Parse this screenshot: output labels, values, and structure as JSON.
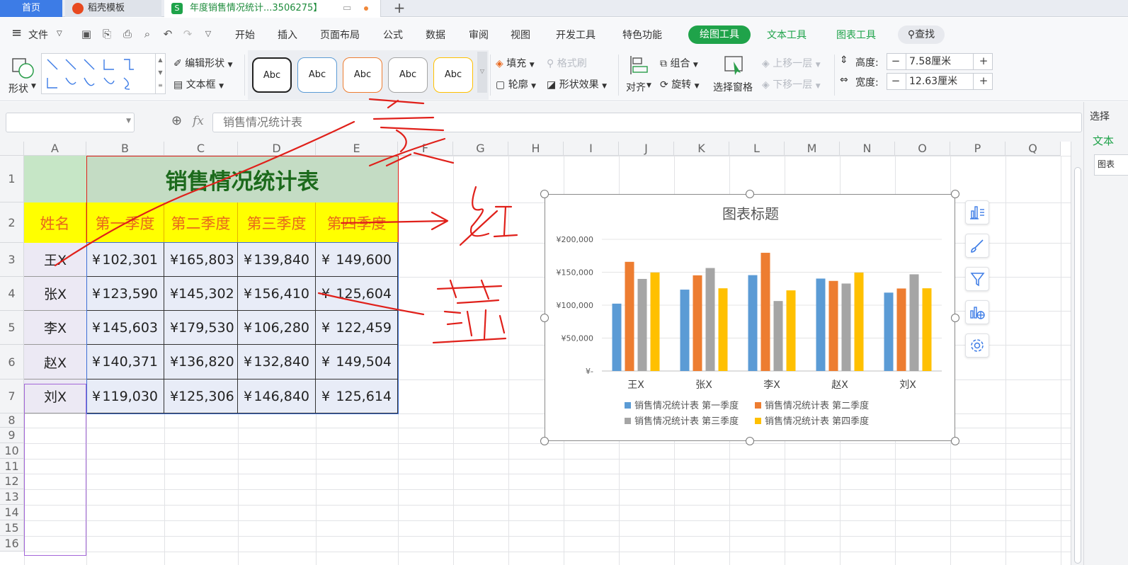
{
  "tabs": {
    "home": "首页",
    "daoke": "稻壳模板",
    "doc": "年度销售情况统计...3506275】"
  },
  "menu": {
    "file": "文件",
    "items": [
      "开始",
      "插入",
      "页面布局",
      "公式",
      "数据",
      "审阅",
      "视图",
      "开发工具",
      "特色功能"
    ],
    "draw_tools": "绘图工具",
    "text_tools": "文本工具",
    "chart_tools": "图表工具",
    "find": "查找"
  },
  "ribbon": {
    "shape": "形状",
    "edit_shape": "编辑形状",
    "textbox": "文本框",
    "style_label": "Abc",
    "styles": [
      {
        "border": "#222222"
      },
      {
        "border": "#5b9bd5"
      },
      {
        "border": "#ed7d31"
      },
      {
        "border": "#a5a5a5"
      },
      {
        "border": "#ffc000"
      }
    ],
    "fill": "填充",
    "format_painter": "格式刷",
    "outline": "轮廓",
    "shape_effect": "形状效果",
    "align": "对齐",
    "group": "组合",
    "rotate": "旋转",
    "select_pane": "选择窗格",
    "bring_forward": "上移一层",
    "send_backward": "下移一层",
    "height_label": "高度:",
    "height_value": "7.58厘米",
    "width_label": "宽度:",
    "width_value": "12.63厘米"
  },
  "formula": {
    "fx": "fx",
    "content": "销售情况统计表"
  },
  "right_panel": {
    "title": "选择",
    "tab": "文本",
    "item": "图表"
  },
  "sheet": {
    "columns": [
      "A",
      "B",
      "C",
      "D",
      "E",
      "F",
      "G",
      "H",
      "I",
      "J",
      "K",
      "L",
      "M",
      "N",
      "O",
      "P",
      "Q"
    ],
    "rows": [
      "1",
      "2",
      "3",
      "4",
      "5",
      "6",
      "7",
      "8",
      "9",
      "10",
      "11",
      "12",
      "13",
      "14",
      "15",
      "16"
    ],
    "title": "销售情况统计表",
    "headers": [
      "姓名",
      "第一季度",
      "第二季度",
      "第三季度",
      "第四季度"
    ],
    "currency": "¥",
    "data": [
      [
        "王X",
        "102,301",
        "165,803",
        "139,840",
        "149,600"
      ],
      [
        "张X",
        "123,590",
        "145,302",
        "156,410",
        "125,604"
      ],
      [
        "李X",
        "145,603",
        "179,530",
        "106,280",
        "122,459"
      ],
      [
        "赵X",
        "140,371",
        "136,820",
        "132,840",
        "149,504"
      ],
      [
        "刘X",
        "119,030",
        "125,306",
        "146,840",
        "125,614"
      ]
    ]
  },
  "annotations": {
    "huang": "黄",
    "hong": "红",
    "lan": "蓝",
    "color": "#e0201a"
  },
  "chart_data": {
    "type": "bar",
    "title": "图表标题",
    "categories": [
      "王X",
      "张X",
      "李X",
      "赵X",
      "刘X"
    ],
    "series": [
      {
        "name": "销售情况统计表 第一季度",
        "color": "#5b9bd5",
        "values": [
          102301,
          123590,
          145603,
          140371,
          119030
        ]
      },
      {
        "name": "销售情况统计表 第二季度",
        "color": "#ed7d31",
        "values": [
          165803,
          145302,
          179530,
          136820,
          125306
        ]
      },
      {
        "name": "销售情况统计表 第三季度",
        "color": "#a5a5a5",
        "values": [
          139840,
          156410,
          106280,
          132840,
          146840
        ]
      },
      {
        "name": "销售情况统计表 第四季度",
        "color": "#ffc000",
        "values": [
          149600,
          125604,
          122459,
          149504,
          125614
        ]
      }
    ],
    "ylim": [
      0,
      200000
    ],
    "yticks": [
      "¥-",
      "¥50,000",
      "¥100,000",
      "¥150,000",
      "¥200,000"
    ],
    "grid": true,
    "legend": "bottom"
  }
}
